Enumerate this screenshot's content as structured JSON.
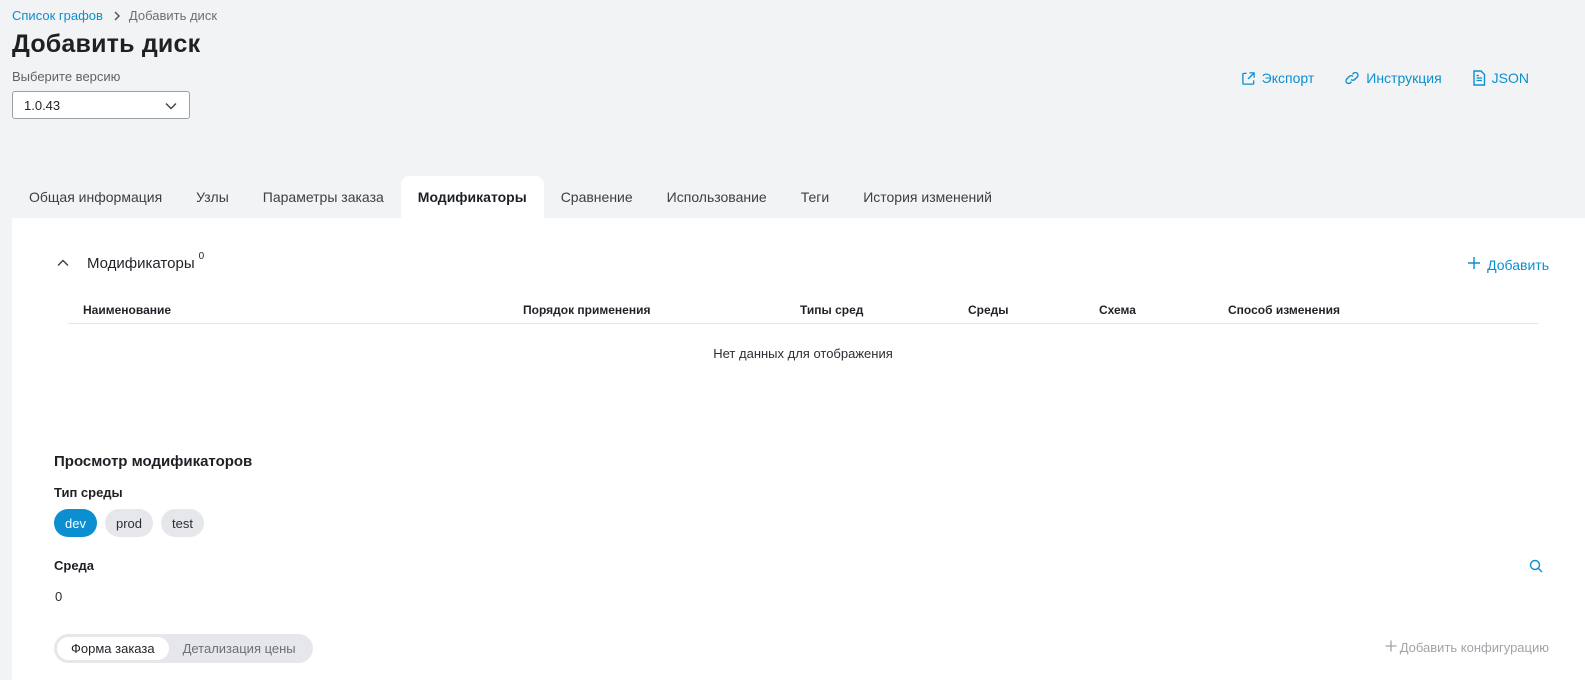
{
  "breadcrumb": {
    "parent": "Список графов",
    "current": "Добавить диск"
  },
  "page": {
    "title": "Добавить диск"
  },
  "version": {
    "label": "Выберите версию",
    "value": "1.0.43"
  },
  "actions": {
    "export": "Экспорт",
    "instruction": "Инструкция",
    "json": "JSON"
  },
  "tabs": [
    {
      "label": "Общая информация",
      "active": false
    },
    {
      "label": "Узлы",
      "active": false
    },
    {
      "label": "Параметры заказа",
      "active": false
    },
    {
      "label": "Модификаторы",
      "active": true
    },
    {
      "label": "Сравнение",
      "active": false
    },
    {
      "label": "Использование",
      "active": false
    },
    {
      "label": "Теги",
      "active": false
    },
    {
      "label": "История изменений",
      "active": false
    }
  ],
  "modifiers": {
    "title": "Модификаторы",
    "count": "0",
    "add_label": "Добавить",
    "columns": [
      "Наименование",
      "Порядок применения",
      "Типы сред",
      "Среды",
      "Схема",
      "Способ изменения"
    ],
    "empty_text": "Нет данных для отображения"
  },
  "view": {
    "title": "Просмотр модификаторов",
    "env_type_label": "Тип среды",
    "env_types": [
      {
        "label": "dev",
        "active": true
      },
      {
        "label": "prod",
        "active": false
      },
      {
        "label": "test",
        "active": false
      }
    ],
    "env_label": "Среда",
    "env_count": "0",
    "segments": [
      {
        "label": "Форма заказа",
        "active": true
      },
      {
        "label": "Детализация цены",
        "active": false
      }
    ],
    "add_config_label": "Добавить конфигурацию"
  },
  "colors": {
    "accent": "#0b8fd0",
    "background": "#f2f3f5",
    "panel": "#ffffff"
  }
}
